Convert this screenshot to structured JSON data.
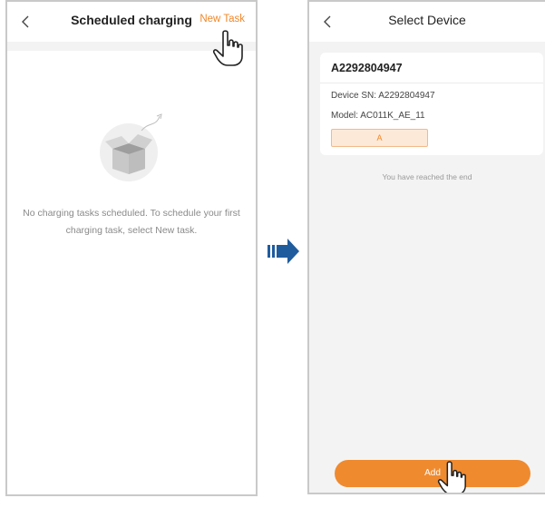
{
  "left_screen": {
    "back_icon": "chevron-left-icon",
    "title": "Scheduled charging",
    "new_task_label": "New Task",
    "empty_message": "No charging tasks scheduled. To schedule your first charging task, select New task.",
    "empty_illustration": "empty-box-icon"
  },
  "right_screen": {
    "back_icon": "chevron-left-icon",
    "title": "Select Device",
    "device": {
      "name": "A2292804947",
      "sn_label": "Device SN:",
      "sn_value": "A2292804947",
      "model_label": "Model:",
      "model_value": "AC011K_AE_11",
      "tag": "A"
    },
    "end_text": "You have reached the end",
    "add_label": "Add"
  },
  "transition_icon": "arrow-right-icon",
  "pointer_icon": "hand-pointer-icon",
  "colors": {
    "accent": "#f0882b",
    "button": "#ef8a2f",
    "arrow": "#1f5c9e",
    "background_gray": "#f3f3f3"
  }
}
